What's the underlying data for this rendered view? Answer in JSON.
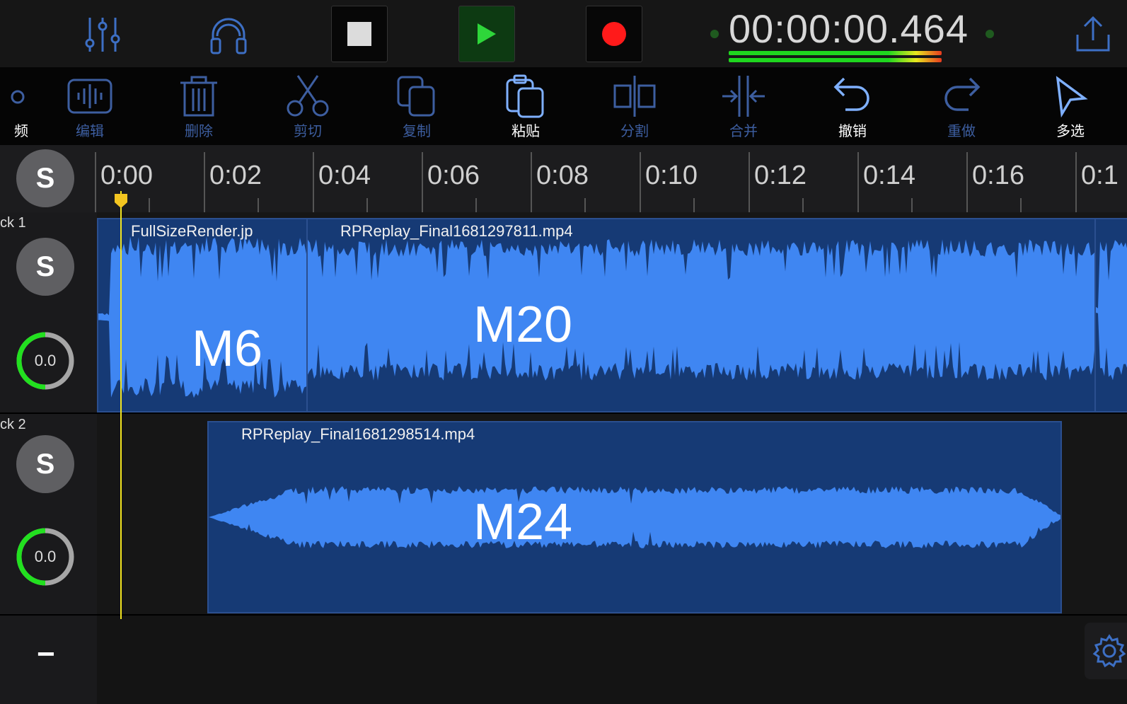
{
  "transport": {
    "timecode": "00:00:00.464",
    "mixer_icon": "mixer-sliders-icon",
    "headphones_icon": "headphones-icon",
    "stop_icon": "stop-icon",
    "play_icon": "play-icon",
    "record_icon": "record-icon",
    "export_icon": "share-export-icon",
    "level_fraction": 0.86
  },
  "toolbar": {
    "items": [
      {
        "label": "频",
        "icon": "truncated-icon",
        "state": "dim"
      },
      {
        "label": "编辑",
        "icon": "waveform-edit-icon",
        "state": "dim"
      },
      {
        "label": "删除",
        "icon": "trash-icon",
        "state": "dim"
      },
      {
        "label": "剪切",
        "icon": "scissors-icon",
        "state": "dim"
      },
      {
        "label": "复制",
        "icon": "copy-icon",
        "state": "dim"
      },
      {
        "label": "粘贴",
        "icon": "paste-icon",
        "state": "lit"
      },
      {
        "label": "分割",
        "icon": "split-icon",
        "state": "dim"
      },
      {
        "label": "合并",
        "icon": "merge-icon",
        "state": "dim"
      },
      {
        "label": "撤销",
        "icon": "undo-icon",
        "state": "lit"
      },
      {
        "label": "重做",
        "icon": "redo-icon",
        "state": "dim"
      },
      {
        "label": "多选",
        "icon": "select-pointer-icon",
        "state": "lit"
      }
    ]
  },
  "ruler": {
    "solo_label": "S",
    "ticks": [
      "0:00",
      "0:02",
      "0:04",
      "0:06",
      "0:08",
      "0:10",
      "0:12",
      "0:14",
      "0:16",
      "0:1"
    ]
  },
  "tracks": [
    {
      "name": "ck 1",
      "solo_label": "S",
      "volume": "0.0",
      "clips": [
        {
          "title": "FullSizeRender.jp",
          "marker": "M6"
        },
        {
          "title": "RPReplay_Final1681297811.mp4",
          "marker": "M20"
        }
      ]
    },
    {
      "name": "ck 2",
      "solo_label": "S",
      "volume": "0.0",
      "clips": [
        {
          "title": "RPReplay_Final1681298514.mp4",
          "marker": "M24"
        }
      ]
    }
  ],
  "footer": {
    "remove_track_label": "−",
    "settings_icon": "gear-icon"
  },
  "colors": {
    "accent": "#3d7df0",
    "waveform": "#3f86f2",
    "clip_bg": "#163a75",
    "playhead": "#f3e520",
    "record": "#ff1a1a",
    "play": "#2ed63a"
  }
}
